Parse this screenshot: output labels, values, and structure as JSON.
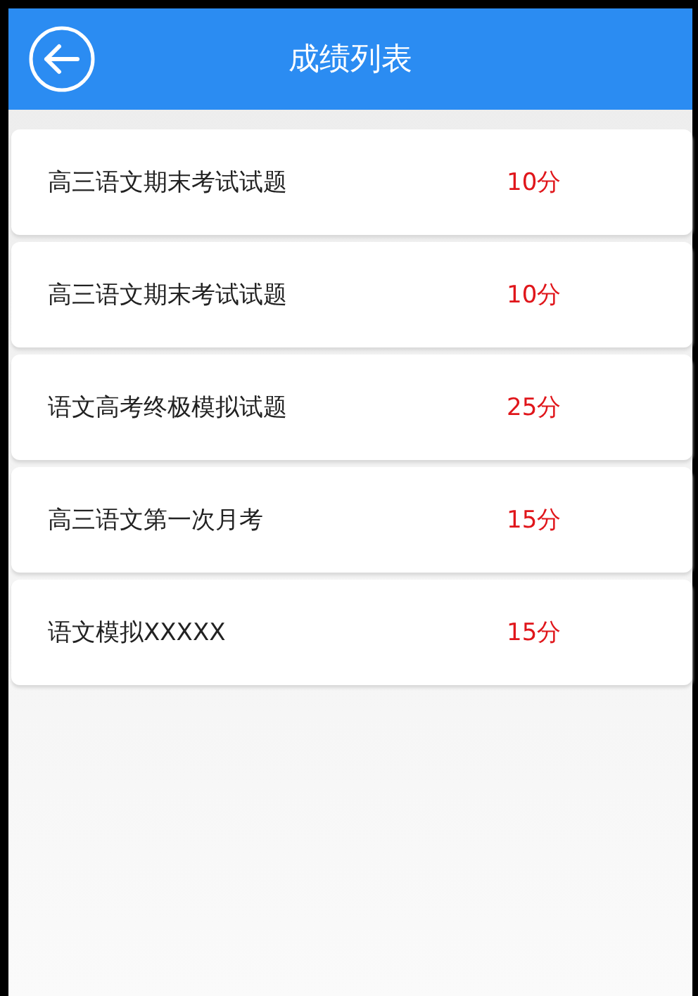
{
  "header": {
    "title": "成绩列表"
  },
  "scores": [
    {
      "name": "高三语文期末考试试题",
      "score": "10分"
    },
    {
      "name": "高三语文期末考试试题",
      "score": "10分"
    },
    {
      "name": "语文高考终极模拟试题",
      "score": "25分"
    },
    {
      "name": "高三语文第一次月考",
      "score": "15分"
    },
    {
      "name": "语文模拟XXXXX",
      "score": "15分"
    }
  ]
}
